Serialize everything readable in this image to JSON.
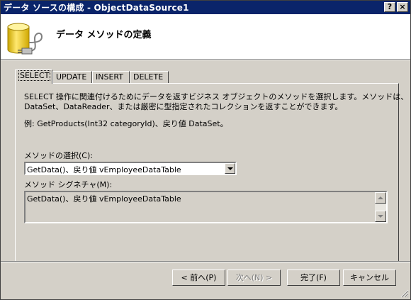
{
  "window": {
    "title": "データ ソースの構成 - ObjectDataSource1",
    "help_button": "?",
    "close_button": "×"
  },
  "header": {
    "title": "データ メソッドの定義"
  },
  "tabs": [
    {
      "label": "SELECT",
      "active": true
    },
    {
      "label": "UPDATE",
      "active": false
    },
    {
      "label": "INSERT",
      "active": false
    },
    {
      "label": "DELETE",
      "active": false
    }
  ],
  "panel": {
    "description_line1": "SELECT 操作に関連付けるためにデータを返すビジネス オブジェクトのメソッドを選択します。メソッドは、",
    "description_line2": "DataSet、DataReader、または厳密に型指定されたコレクションを返すことができます。",
    "example": "例: GetProducts(Int32 categoryId)、戻り値 DataSet。",
    "method_label": "メソッドの選択(C):",
    "method_value": "GetData()、戻り値 vEmployeeDataTable",
    "signature_label": "メソッド シグネチャ(M):",
    "signature_value": "GetData()、戻り値 vEmployeeDataTable"
  },
  "buttons": {
    "back": "< 前へ(P)",
    "next": "次へ(N) >",
    "finish": "完了(F)",
    "cancel": "キャンセル"
  }
}
